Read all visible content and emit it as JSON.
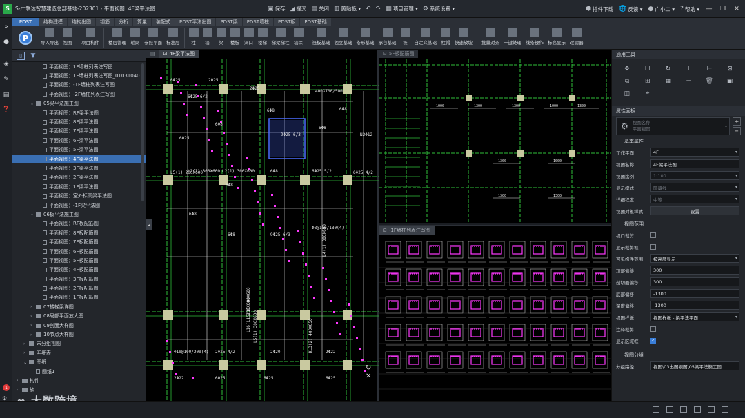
{
  "titlebar": {
    "logo": "S",
    "title": "S-广联达智慧建造总部基地-202301 - 平面视图: 4F梁平法图",
    "actions": [
      {
        "icon": "save-icon",
        "glyph": "▣",
        "label": "保存"
      },
      {
        "icon": "submit-icon",
        "glyph": "◢",
        "label": "提交"
      },
      {
        "icon": "close-doc-icon",
        "glyph": "▤",
        "label": "关闭"
      },
      {
        "icon": "clipboard-icon",
        "glyph": "▥",
        "label": "剪贴板 ▾"
      },
      {
        "icon": "undo-icon",
        "glyph": "↶",
        "label": ""
      },
      {
        "icon": "redo-icon",
        "glyph": "↷",
        "label": ""
      },
      {
        "icon": "project-manage-icon",
        "glyph": "▦",
        "label": "项目管理 ▾"
      },
      {
        "icon": "system-settings-icon",
        "glyph": "⚙",
        "label": "系统设置 ▾"
      }
    ],
    "right": [
      {
        "icon": "plugin-download-icon",
        "glyph": "⬢",
        "label": "插件下载"
      },
      {
        "icon": "feedback-icon",
        "glyph": "🌐",
        "label": "反馈 ▾"
      },
      {
        "icon": "user-avatar-icon",
        "glyph": "●",
        "label": "广小二 ▾"
      },
      {
        "icon": "help-icon",
        "glyph": "?",
        "label": "帮助 ▾"
      }
    ],
    "window": [
      "—",
      "❐",
      "✕"
    ]
  },
  "ribbon": {
    "tabs": [
      "PDST",
      "结构建模",
      "结构出图",
      "钢筋",
      "分析",
      "算量",
      "装配式",
      "PDST平法出图",
      "PDST梁",
      "PDST墙柱",
      "PDST板",
      "PDST基础"
    ],
    "logo": "P",
    "groups": [
      [
        "导入导出",
        "视图"
      ],
      [
        "项目构件"
      ],
      [
        "楼层管理",
        "轴网",
        "参照平面",
        "标准层"
      ],
      [
        "柱",
        "墙",
        "梁",
        "楼板",
        "洞口",
        "楼梯",
        "梯梁梯柱",
        "墙垛"
      ],
      [
        "筏板基础",
        "独立基础",
        "条形基础",
        "承台基础",
        "桩",
        "自定义基础",
        "柱帽",
        "快速放坡"
      ],
      [
        "批量对齐",
        "一键处理",
        "线条操作",
        "标高显示",
        "过滤器"
      ]
    ]
  },
  "tree": {
    "items": [
      {
        "label": "平面视图：1F墙柱列表注写图",
        "indent": 3,
        "type": "file"
      },
      {
        "label": "平面视图：1F墙柱列表注写图_01031040",
        "indent": 3,
        "type": "file"
      },
      {
        "label": "平面视图：-1F墙柱列表注写图",
        "indent": 3,
        "type": "file"
      },
      {
        "label": "平面视图：-2F墙柱列表注写图",
        "indent": 3,
        "type": "file"
      },
      {
        "label": "05梁平法施工图",
        "indent": 2,
        "type": "folder",
        "open": true
      },
      {
        "label": "平面视图：RF梁平法图",
        "indent": 3,
        "type": "file"
      },
      {
        "label": "平面视图：8F梁平法图",
        "indent": 3,
        "type": "file"
      },
      {
        "label": "平面视图：7F梁平法图",
        "indent": 3,
        "type": "file"
      },
      {
        "label": "平面视图：6F梁平法图",
        "indent": 3,
        "type": "file"
      },
      {
        "label": "平面视图：5F梁平法图",
        "indent": 3,
        "type": "file"
      },
      {
        "label": "平面视图：4F梁平法图",
        "indent": 3,
        "type": "file",
        "selected": true
      },
      {
        "label": "平面视图：3F梁平法图",
        "indent": 3,
        "type": "file"
      },
      {
        "label": "平面视图：2F梁平法图",
        "indent": 3,
        "type": "file"
      },
      {
        "label": "平面视图：1F梁平法图",
        "indent": 3,
        "type": "file"
      },
      {
        "label": "平面视图：室外标高梁平法图",
        "indent": 3,
        "type": "file"
      },
      {
        "label": "平面视图：-1F梁平法图",
        "indent": 3,
        "type": "file"
      },
      {
        "label": "06板平法施工图",
        "indent": 2,
        "type": "folder",
        "open": true
      },
      {
        "label": "平面视图：RF板配筋图",
        "indent": 3,
        "type": "file"
      },
      {
        "label": "平面视图：8F板配筋图",
        "indent": 3,
        "type": "file"
      },
      {
        "label": "平面视图：7F板配筋图",
        "indent": 3,
        "type": "file"
      },
      {
        "label": "平面视图：6F板配筋图",
        "indent": 3,
        "type": "file"
      },
      {
        "label": "平面视图：5F板配筋图",
        "indent": 3,
        "type": "file"
      },
      {
        "label": "平面视图：4F板配筋图",
        "indent": 3,
        "type": "file"
      },
      {
        "label": "平面视图：3F板配筋图",
        "indent": 3,
        "type": "file"
      },
      {
        "label": "平面视图：2F板配筋图",
        "indent": 3,
        "type": "file"
      },
      {
        "label": "平面视图：1F板配筋图",
        "indent": 3,
        "type": "file"
      },
      {
        "label": "07楼梯梁详图",
        "indent": 2,
        "type": "folder"
      },
      {
        "label": "08局部平面放大图",
        "indent": 2,
        "type": "folder"
      },
      {
        "label": "09剖面大样图",
        "indent": 2,
        "type": "folder"
      },
      {
        "label": "10节点大样图",
        "indent": 2,
        "type": "folder"
      },
      {
        "label": "未分组视图",
        "indent": 1,
        "type": "folder"
      },
      {
        "label": "明细表",
        "indent": 1,
        "type": "folder"
      },
      {
        "label": "图纸",
        "indent": 1,
        "type": "folder",
        "open": true
      },
      {
        "label": "图纸1",
        "indent": 2,
        "type": "file"
      },
      {
        "label": "构件",
        "indent": 0,
        "type": "folder"
      },
      {
        "label": "族",
        "indent": 0,
        "type": "folder"
      }
    ],
    "notification_count": "1",
    "watermark": "大数跨境"
  },
  "views": {
    "view1_tab": "4F梁平法图",
    "view2_tab": "5F板配筋图",
    "view3_tab": "-1F墙柱列表注写图",
    "nav_glyphs": [
      "↻",
      "✕"
    ]
  },
  "cad": {
    "labels1": [
      "6Φ25",
      "6Φ25 6/2",
      "2Φ25",
      "2Φ25",
      "6Φ8",
      "400X700/500",
      "6Φ8",
      "6Φ25",
      "6Φ8",
      "9Φ25 6/3",
      "6Φ8",
      "L5(1) 200X600",
      "L2(1) 300X600",
      "L2(1) 300X600",
      "6Φ8",
      "6Φ25 5/2",
      "6Φ8",
      "6Φ8",
      "6Φ8",
      "9Φ25 6/3",
      "Φ8@100/180(4)",
      "L4(1) 300X600",
      "L15(1) 300X600",
      "L16(1) 200X600",
      "L5(1) 300X600",
      "KL3(2) 400X650",
      "Φ10@100/200(4)",
      "2Φ25 4/2",
      "2Φ20",
      "2Φ22",
      "2Φ22",
      "6Φ25",
      "6Φ25",
      "6Φ25",
      "6Φ25",
      "6Φ25",
      "9Φ25 6/3",
      "6Φ25 4/2",
      "N2Φ12"
    ],
    "colors": {
      "beam": "#2fbf3a",
      "dim": "#e8e8e8",
      "col": "#c9c9a0",
      "accent": "#ff38ff",
      "blue": "#4c6dff"
    }
  },
  "props": {
    "tools_title": "通用工具",
    "tools": [
      {
        "icon": "move-icon",
        "glyph": "✥"
      },
      {
        "icon": "copy-icon",
        "glyph": "❐"
      },
      {
        "icon": "rotate-icon",
        "glyph": "↻"
      },
      {
        "icon": "align-icon",
        "glyph": "⊥"
      },
      {
        "icon": "split-icon",
        "glyph": "⊢"
      },
      {
        "icon": "stretch-icon",
        "glyph": "⊠"
      },
      {
        "icon": "mirror-icon",
        "glyph": "⧉"
      },
      {
        "icon": "offset-icon",
        "glyph": "⊞"
      },
      {
        "icon": "array-icon",
        "glyph": "▦"
      },
      {
        "icon": "trim-icon",
        "glyph": "⊣"
      },
      {
        "icon": "delete-icon",
        "glyph": "🗑"
      },
      {
        "icon": "group-icon",
        "glyph": "▣"
      },
      {
        "icon": "match-icon",
        "glyph": "◫"
      },
      {
        "icon": "pin-icon",
        "glyph": "⌖"
      }
    ],
    "props_title": "属性面板",
    "type_selector": {
      "line1": "视图名称",
      "line2": "平面视图"
    },
    "section_basic": "基本属性",
    "basic": [
      {
        "key": "工作平面",
        "value": "4F",
        "dropdown": true,
        "dim": false
      },
      {
        "key": "视图名称",
        "value": "4F梁平法图",
        "dropdown": false,
        "dim": false
      },
      {
        "key": "视图比例",
        "value": "1:100",
        "dropdown": true,
        "dim": true
      },
      {
        "key": "显示模式",
        "value": "隐藏线",
        "dropdown": true,
        "dim": true
      },
      {
        "key": "详细程度",
        "value": "中等",
        "dropdown": true,
        "dim": true
      }
    ],
    "style_key": "视图对象样式",
    "style_button": "设置",
    "section_range": "视图范围",
    "range_checks": [
      {
        "key": "视口裁剪",
        "checked": false
      },
      {
        "key": "显示裁剪框",
        "checked": false
      }
    ],
    "range": [
      {
        "key": "可见构件范围",
        "value": "按高度显示",
        "dropdown": true
      },
      {
        "key": "顶部偏移",
        "value": "300",
        "dropdown": false
      },
      {
        "key": "剖切面偏移",
        "value": "300",
        "dropdown": false
      },
      {
        "key": "底部偏移",
        "value": "-1300",
        "dropdown": false
      },
      {
        "key": "深度偏移",
        "value": "-1300",
        "dropdown": false
      },
      {
        "key": "视图样板",
        "value": "视图样板 - 梁平法平面",
        "dropdown": true
      }
    ],
    "range_checks2": [
      {
        "key": "注释裁剪",
        "checked": false
      },
      {
        "key": "显示区域框",
        "checked": true
      }
    ],
    "section_group": "视图分组",
    "group_key": "分组路径",
    "group_value": "视图\\03出图视图\\05梁平法施工图"
  }
}
